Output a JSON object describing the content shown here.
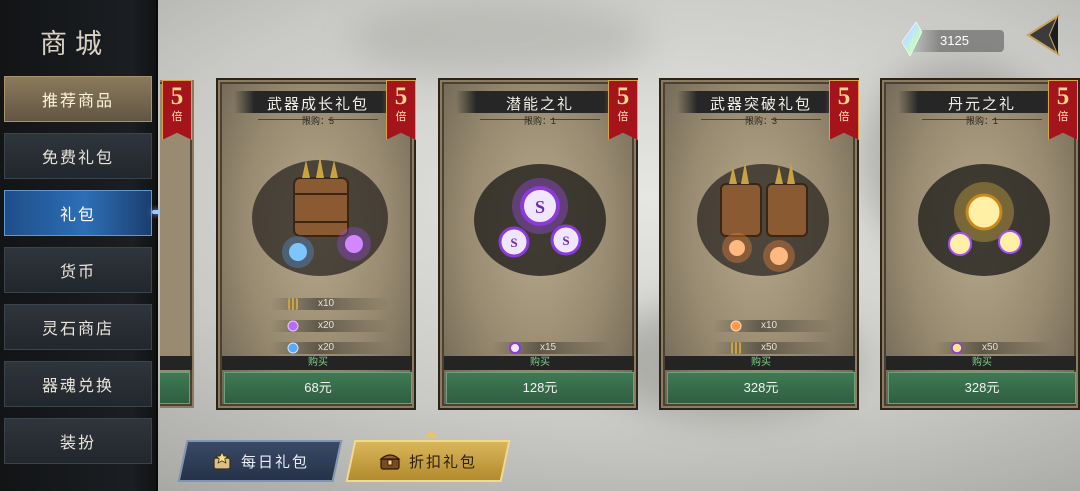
{
  "sidebar": {
    "title": "商城",
    "items": [
      {
        "label": "推荐商品",
        "state": "featured"
      },
      {
        "label": "免费礼包",
        "state": "normal"
      },
      {
        "label": "礼包",
        "state": "active"
      },
      {
        "label": "货币",
        "state": "normal"
      },
      {
        "label": "灵石商店",
        "state": "normal"
      },
      {
        "label": "器魂兑换",
        "state": "normal"
      },
      {
        "label": "装扮",
        "state": "normal"
      }
    ]
  },
  "currency": {
    "icon": "crystal-gem-icon",
    "value": "3125"
  },
  "back_icon": "back-arrow-icon",
  "cards": [
    {
      "title": "武器成长礼包",
      "limit": "限购：5",
      "multiplier": "5",
      "multiplier_unit": "倍",
      "items": [
        {
          "icon": "arrow-bundle-icon",
          "qty": "x10"
        },
        {
          "icon": "purple-orb-icon",
          "qty": "x20"
        },
        {
          "icon": "blue-orb-icon",
          "qty": "x20"
        }
      ],
      "buy_label": "购买",
      "price": "68元"
    },
    {
      "title": "潜能之礼",
      "limit": "限购：1",
      "multiplier": "5",
      "multiplier_unit": "倍",
      "items": [
        {
          "icon": "potential-coin-icon",
          "qty": "x15"
        }
      ],
      "buy_label": "购买",
      "price": "128元"
    },
    {
      "title": "武器突破礼包",
      "limit": "限购：3",
      "multiplier": "5",
      "multiplier_unit": "倍",
      "items": [
        {
          "icon": "orange-orb-icon",
          "qty": "x10"
        },
        {
          "icon": "arrow-bundle-icon",
          "qty": "x50"
        }
      ],
      "buy_label": "购买",
      "price": "328元"
    },
    {
      "title": "丹元之礼",
      "limit": "限购：1",
      "multiplier": "5",
      "multiplier_unit": "倍",
      "items": [
        {
          "icon": "golden-orb-icon",
          "qty": "x50"
        }
      ],
      "buy_label": "购买",
      "price": "328元"
    }
  ],
  "bottom_tabs": [
    {
      "label": "每日礼包",
      "icon": "star-chest-icon"
    },
    {
      "label": "折扣礼包",
      "icon": "treasure-chest-icon"
    }
  ],
  "colors": {
    "active_blue": "#2d6fb6",
    "badge_red": "#a5141a",
    "price_green": "#3f7a54",
    "discount_gold": "#d9b65a"
  }
}
